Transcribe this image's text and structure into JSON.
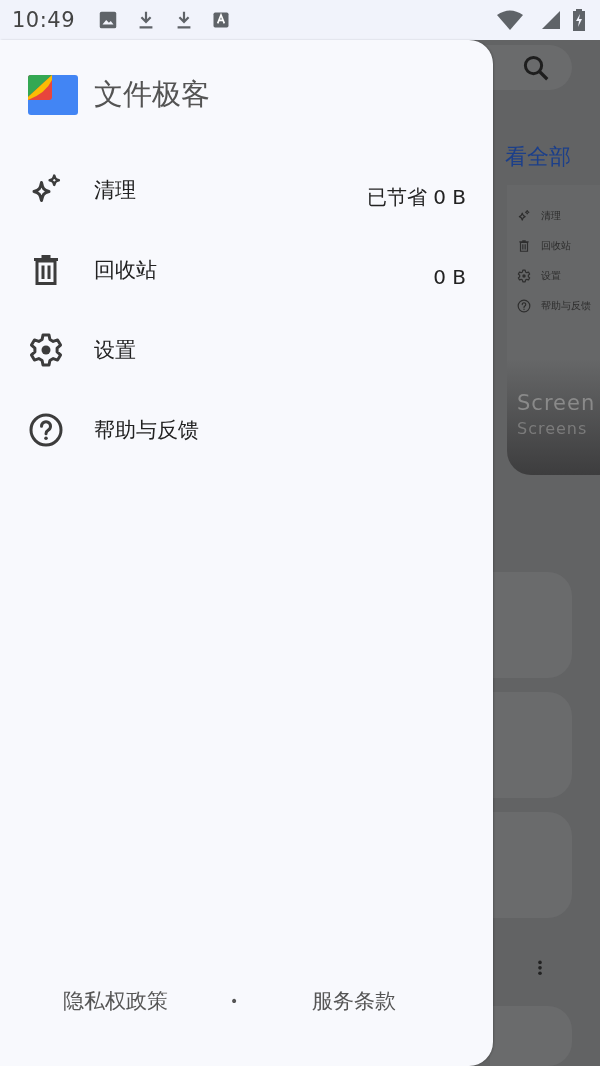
{
  "status_bar": {
    "time": "10:49"
  },
  "background": {
    "link": "看全部",
    "preview_card": {
      "menu": [
        {
          "kind": "clean",
          "label": "清理"
        },
        {
          "kind": "trash",
          "label": "回收站"
        },
        {
          "kind": "settings",
          "label": "设置"
        },
        {
          "kind": "help",
          "label": "帮助与反馈"
        }
      ],
      "title": "Screen",
      "subtitle": "Screens"
    }
  },
  "drawer": {
    "app_name": "文件极客",
    "items": [
      {
        "kind": "clean",
        "label": "清理",
        "value": "已节省 0 B"
      },
      {
        "kind": "trash",
        "label": "回收站",
        "value": "0 B"
      },
      {
        "kind": "settings",
        "label": "设置"
      },
      {
        "kind": "help",
        "label": "帮助与反馈"
      }
    ],
    "footer": {
      "links": [
        "隐私权政策",
        "服务条款"
      ],
      "separator": "•"
    }
  }
}
